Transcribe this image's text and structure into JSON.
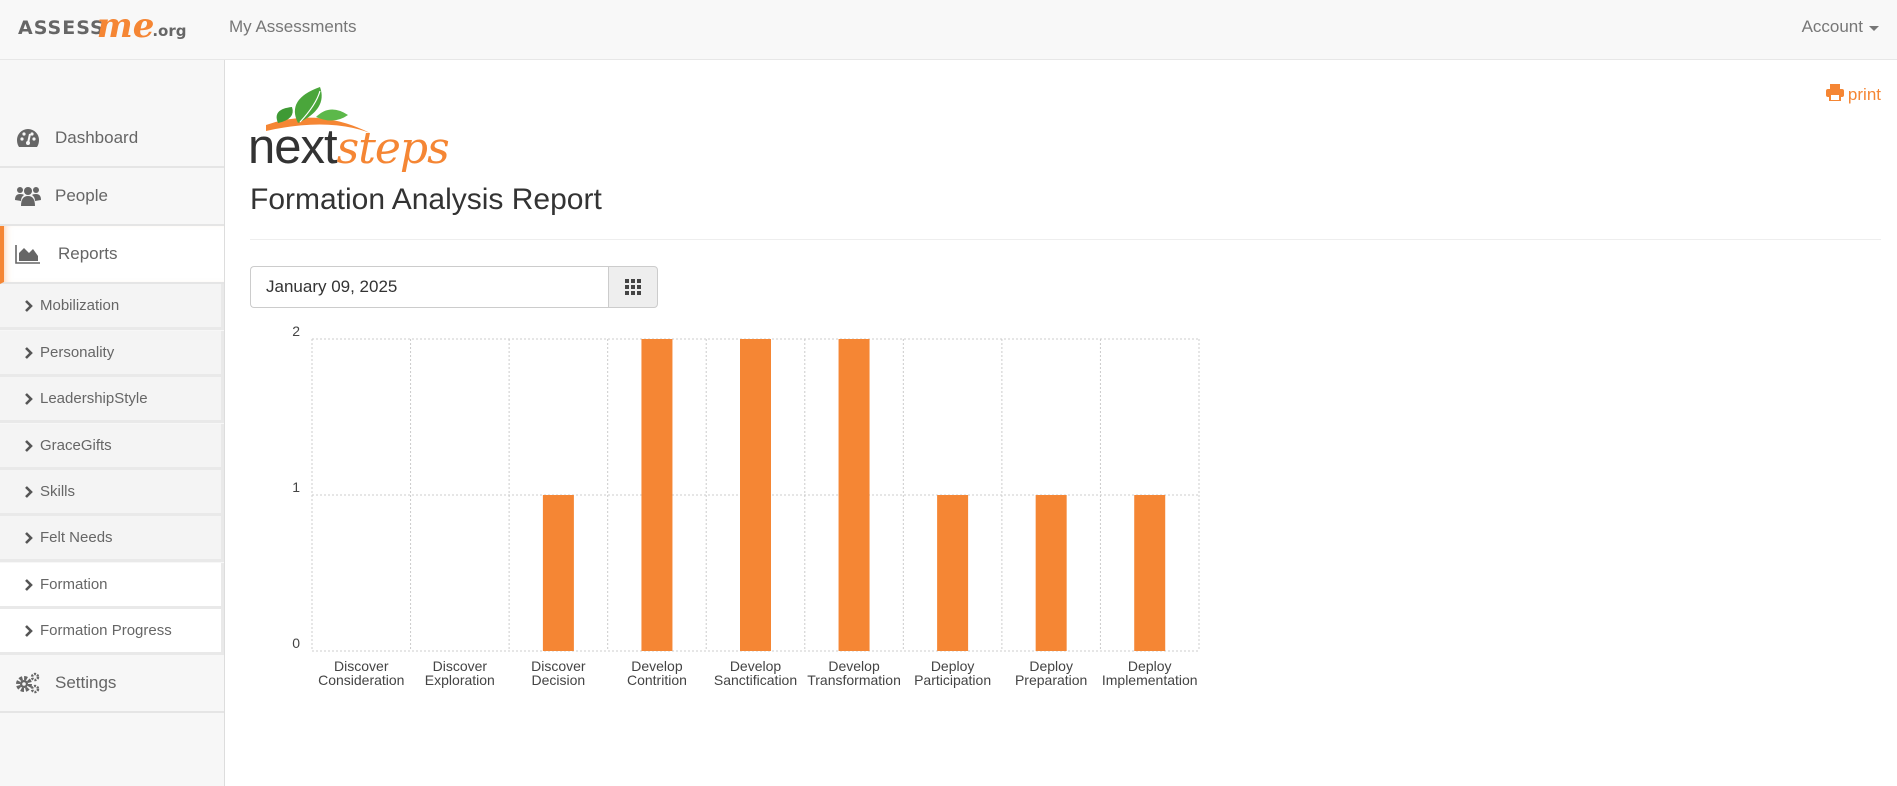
{
  "navbar": {
    "brand": {
      "part1": "ASSESS",
      "part2": "me",
      "part3": ".org"
    },
    "nav_link": "My Assessments",
    "account_label": "Account"
  },
  "sidebar": {
    "main_items": [
      {
        "label": "Dashboard",
        "icon": "dashboard-icon"
      },
      {
        "label": "People",
        "icon": "people-icon"
      },
      {
        "label": "Reports",
        "icon": "area-chart-icon",
        "active": true
      }
    ],
    "report_items": [
      {
        "label": "Mobilization"
      },
      {
        "label": "Personality"
      },
      {
        "label": "LeadershipStyle"
      },
      {
        "label": "GraceGifts"
      },
      {
        "label": "Skills"
      },
      {
        "label": "Felt Needs"
      },
      {
        "label": "Formation"
      },
      {
        "label": "Formation Progress"
      }
    ],
    "settings_label": "Settings"
  },
  "main": {
    "print_label": "print",
    "logo": {
      "next": "next",
      "steps": "steps"
    },
    "title": "Formation Analysis Report",
    "date_value": "January 09, 2025",
    "calendar_button": "calendar-icon"
  },
  "colors": {
    "accent": "#f58634",
    "bar": "#f58634",
    "grid": "#cccccc"
  },
  "chart_data": {
    "type": "bar",
    "title": "",
    "xlabel": "",
    "ylabel": "",
    "ylim": [
      0,
      2
    ],
    "yticks": [
      0,
      1,
      2
    ],
    "grid": true,
    "categories": [
      [
        "Discover",
        "Consideration"
      ],
      [
        "Discover",
        "Exploration"
      ],
      [
        "Discover",
        "Decision"
      ],
      [
        "Develop",
        "Contrition"
      ],
      [
        "Develop",
        "Sanctification"
      ],
      [
        "Develop",
        "Transformation"
      ],
      [
        "Deploy",
        "Participation"
      ],
      [
        "Deploy",
        "Preparation"
      ],
      [
        "Deploy",
        "Implementation"
      ]
    ],
    "values": [
      0,
      0,
      1,
      2,
      2,
      2,
      1,
      1,
      1
    ]
  }
}
